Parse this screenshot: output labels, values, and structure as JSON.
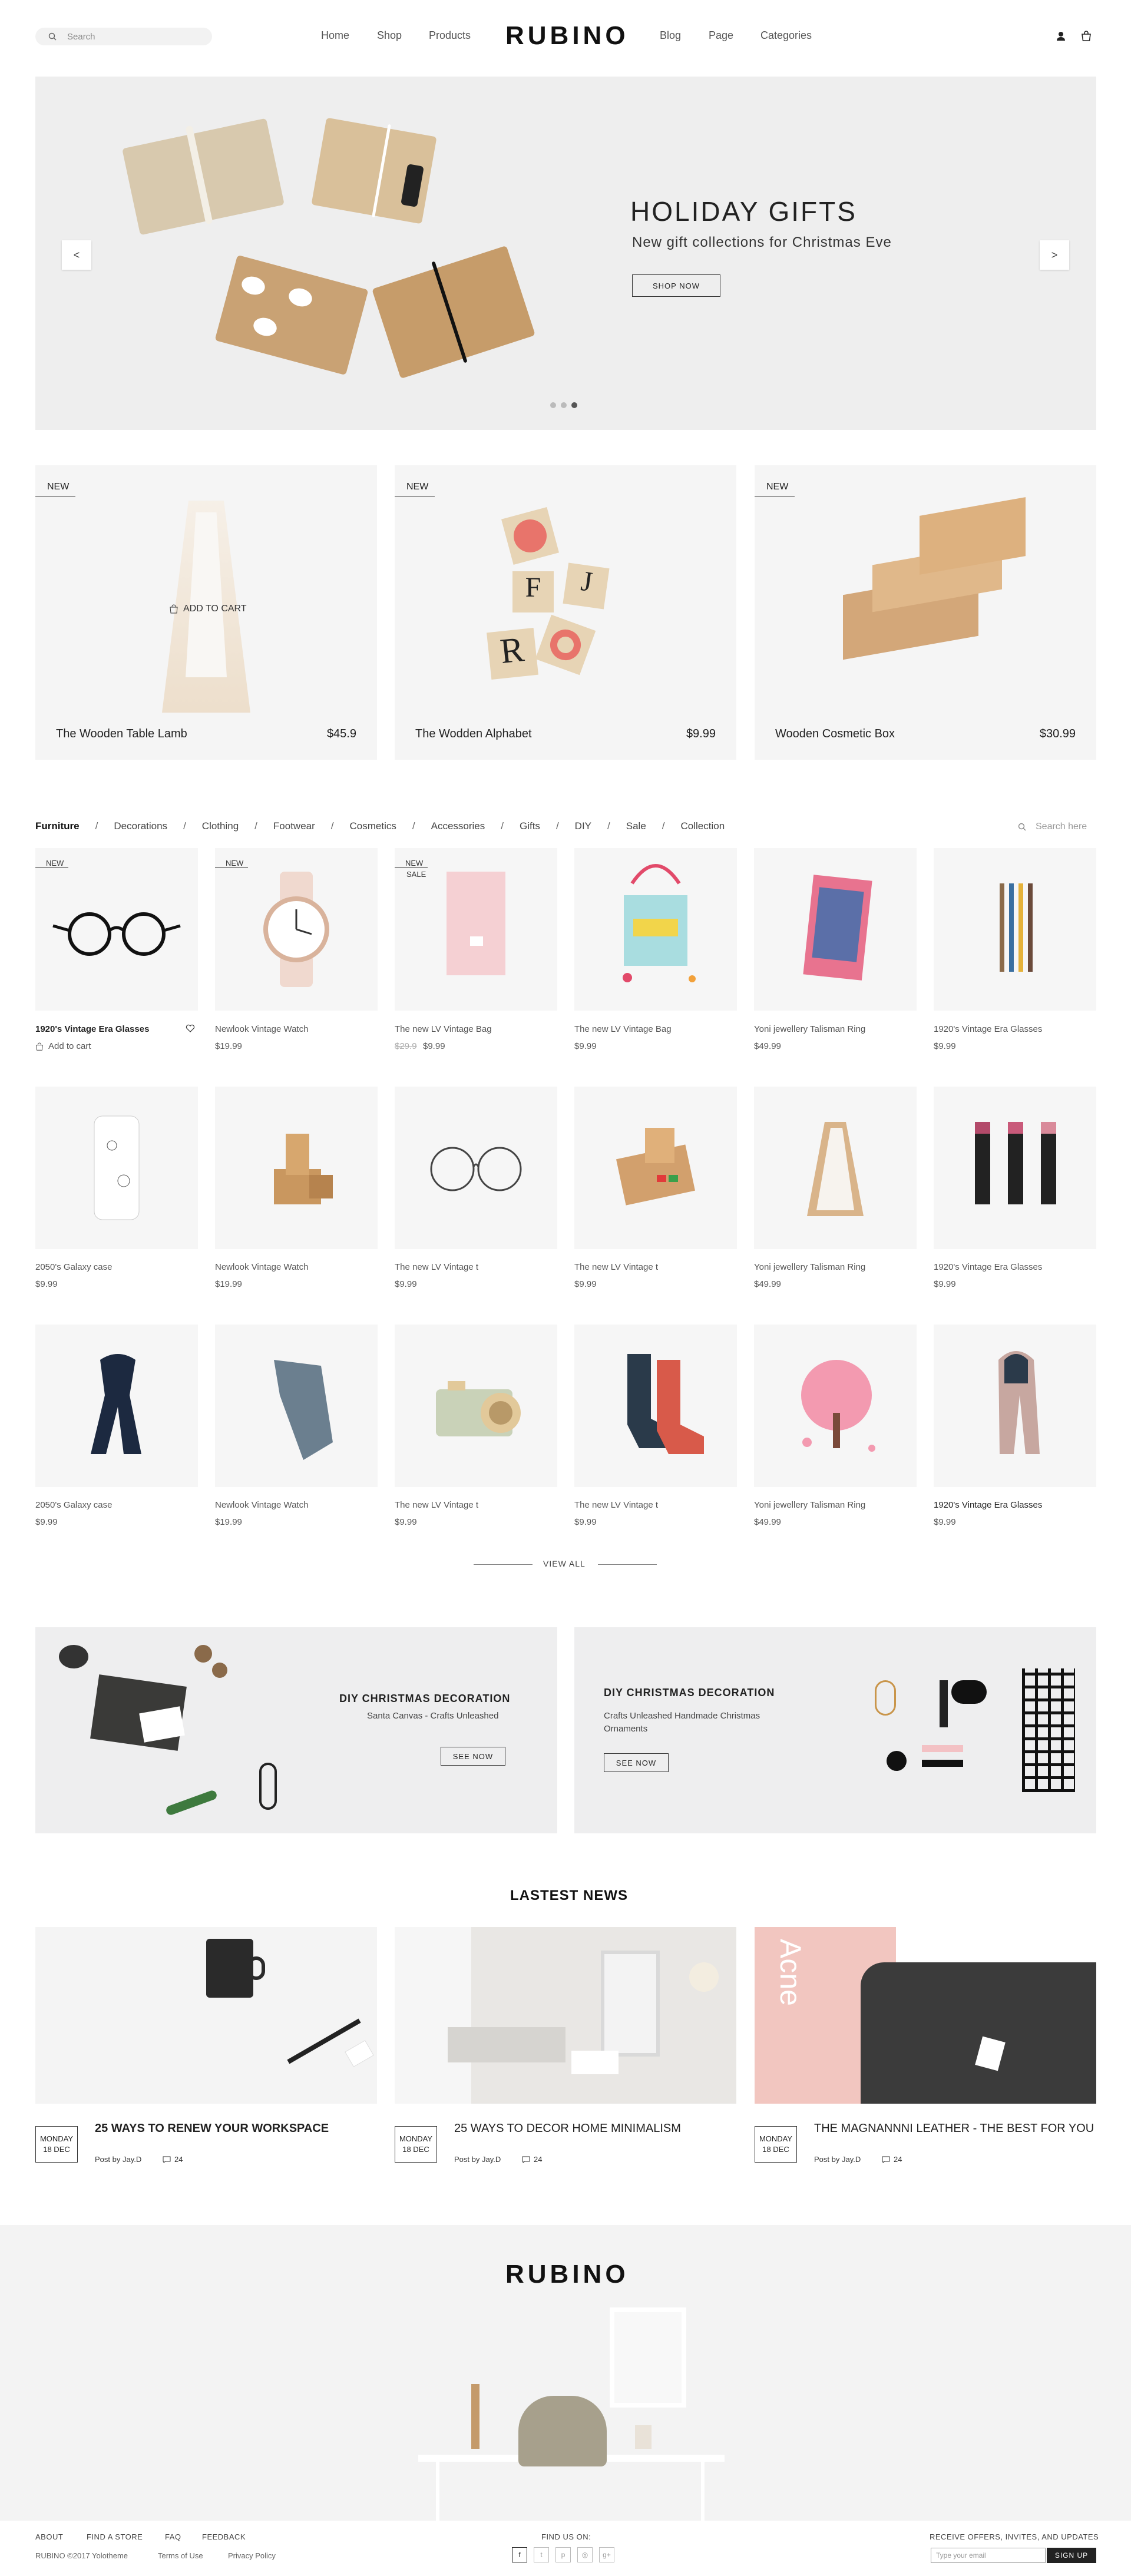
{
  "header": {
    "search_placeholder": "Search",
    "nav_left": [
      "Home",
      "Shop",
      "Products"
    ],
    "logo": "RUBINO",
    "nav_right": [
      "Blog",
      "Page",
      "Categories"
    ]
  },
  "hero": {
    "title": "HOLIDAY GIFTS",
    "subtitle": "New gift collections for Christmas Eve",
    "button": "SHOP NOW",
    "prev": "<",
    "next": ">",
    "active_slide": 3,
    "slide_count": 3
  },
  "featured": [
    {
      "badge": "NEW",
      "name": "The Wooden Table Lamb",
      "price": "$45.9",
      "hover_label": "ADD TO CART"
    },
    {
      "badge": "NEW",
      "name": "The Wodden Alphabet",
      "price": "$9.99"
    },
    {
      "badge": "NEW",
      "name": "Wooden Cosmetic Box",
      "price": "$30.99"
    }
  ],
  "categories": {
    "items": [
      "Furniture",
      "Decorations",
      "Clothing",
      "Footwear",
      "Cosmetics",
      "Accessories",
      "Gifts",
      "DIY",
      "Sale",
      "Collection"
    ],
    "active": "Furniture",
    "separator": "/",
    "search_placeholder": "Search here"
  },
  "products": [
    {
      "name": "1920's Vintage Era Glasses",
      "price": "",
      "badge": "NEW",
      "action": "Add to cart"
    },
    {
      "name": "Newlook Vintage Watch",
      "price": "$19.99",
      "badge": "NEW"
    },
    {
      "name": "The new LV Vintage Bag",
      "price": "$9.99",
      "old_price": "$29.9",
      "badge": "NEW",
      "badge2": "SALE"
    },
    {
      "name": "The new LV Vintage Bag",
      "price": "$9.99"
    },
    {
      "name": "Yoni jewellery Talisman Ring",
      "price": "$49.99"
    },
    {
      "name": "1920's Vintage Era Glasses",
      "price": "$9.99"
    },
    {
      "name": "2050's Galaxy case",
      "price": "$9.99"
    },
    {
      "name": "Newlook Vintage Watch",
      "price": "$19.99"
    },
    {
      "name": "The new LV Vintage t",
      "price": "$9.99"
    },
    {
      "name": "The new LV Vintage t",
      "price": "$9.99"
    },
    {
      "name": "Yoni jewellery Talisman Ring",
      "price": "$49.99"
    },
    {
      "name": "1920's Vintage Era Glasses",
      "price": "$9.99"
    },
    {
      "name": "2050's Galaxy case",
      "price": "$9.99"
    },
    {
      "name": "Newlook Vintage Watch",
      "price": "$19.99"
    },
    {
      "name": "The new LV Vintage t",
      "price": "$9.99"
    },
    {
      "name": "The new LV Vintage t",
      "price": "$9.99"
    },
    {
      "name": "Yoni jewellery Talisman Ring",
      "price": "$49.99"
    },
    {
      "name": "1920's Vintage Era Glasses",
      "price": "$9.99"
    }
  ],
  "view_all": "VIEW ALL",
  "banners": [
    {
      "title": "DIY CHRISTMAS DECORATION",
      "text": "Santa Canvas - Crafts Unleashed",
      "button": "SEE NOW"
    },
    {
      "title": "DIY CHRISTMAS DECORATION",
      "text": "Crafts Unleashed Handmade Christmas Ornaments",
      "button": "SEE NOW"
    }
  ],
  "news": {
    "heading": "LASTEST NEWS",
    "posts": [
      {
        "day": "MONDAY",
        "date": "18 DEC",
        "title": "25 WAYS TO RENEW YOUR WORKSPACE",
        "author": "Post by Jay.D",
        "comments": "24"
      },
      {
        "day": "MONDAY",
        "date": "18 DEC",
        "title": "25 WAYS TO DECOR HOME MINIMALISM",
        "author": "Post by Jay.D",
        "comments": "24"
      },
      {
        "day": "MONDAY",
        "date": "18 DEC",
        "title": "THE MAGNANNNI LEATHER - THE BEST FOR YOU",
        "author": "Post by Jay.D",
        "comments": "24"
      }
    ],
    "bag_text": "Acne"
  },
  "footer": {
    "logo": "RUBINO",
    "links": [
      "ABOUT",
      "FIND A STORE",
      "FAQ",
      "FEEDBACK"
    ],
    "copyright": "RUBINO ©2017 Yolotheme",
    "terms": "Terms of Use",
    "privacy": "Privacy Policy",
    "find_us": "FIND US ON:",
    "newsletter": "RECEIVE OFFERS, INVITES, AND UPDATES",
    "email_placeholder": "Type your email",
    "signup": "SIGN UP",
    "social_icons": [
      "facebook-icon",
      "twitter-icon",
      "pinterest-icon",
      "instagram-icon",
      "google-plus-icon"
    ]
  }
}
